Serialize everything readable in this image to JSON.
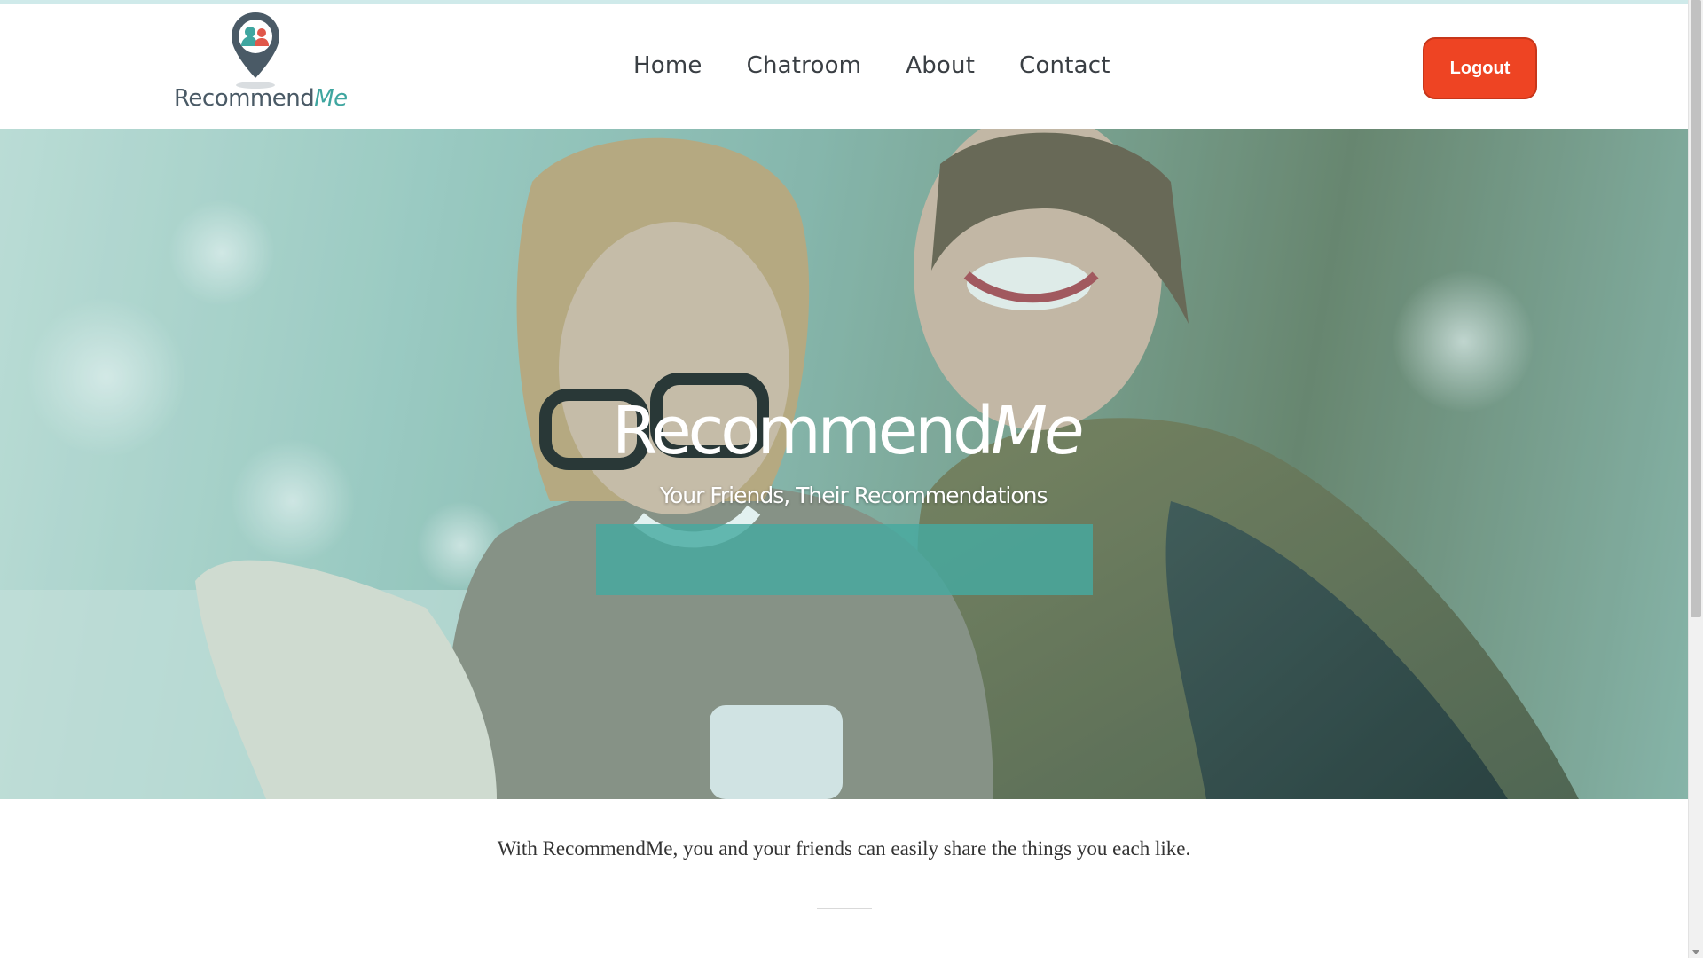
{
  "header": {
    "logo_text": "Recommend",
    "logo_text_accent": "Me",
    "nav": [
      {
        "label": "Home"
      },
      {
        "label": "Chatroom"
      },
      {
        "label": "About"
      },
      {
        "label": "Contact"
      }
    ],
    "logout_label": "Logout"
  },
  "hero": {
    "title": "Recommend",
    "title_accent": "Me",
    "subtitle": "Your Friends, Their Recommendations"
  },
  "main": {
    "intro": "With RecommendMe, you and your friends can easily share the things you each like."
  },
  "colors": {
    "accent": "#3fa6a0",
    "logout": "#ee4423",
    "text": "#333333"
  },
  "icons": {
    "logo": "map-pin-people-icon"
  }
}
